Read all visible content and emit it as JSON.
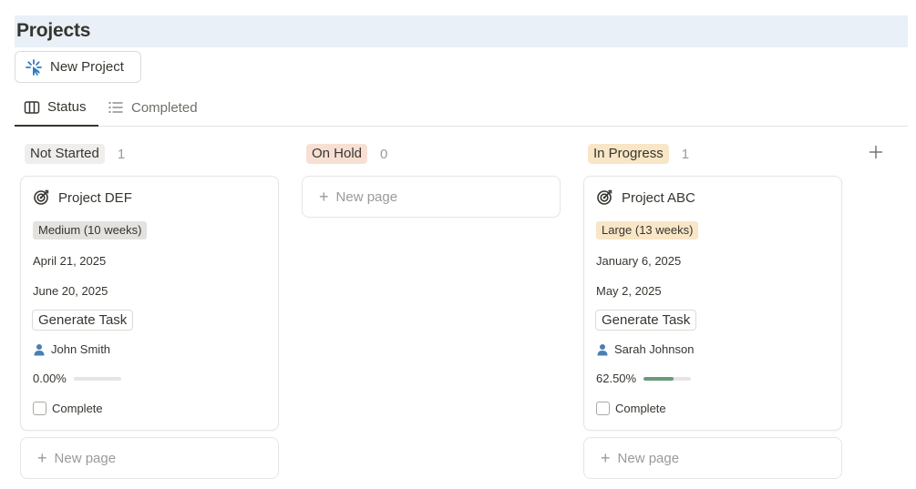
{
  "page": {
    "title": "Projects"
  },
  "toolbar": {
    "new_project_label": "New Project",
    "new_project_icon": "sparkle-icon"
  },
  "tabs": [
    {
      "label": "Status",
      "icon": "board-icon",
      "active": true
    },
    {
      "label": "Completed",
      "icon": "list-icon",
      "active": false
    }
  ],
  "groups": [
    {
      "label": "Not Started",
      "count": "1",
      "pill_color": "#efeeec",
      "cards": [
        {
          "title": "Project DEF",
          "icon": "target-icon",
          "size": "Medium (10 weeks)",
          "size_color": "#e3e2df",
          "start_date": "April 21, 2025",
          "end_date": "June 20, 2025",
          "button_label": "Generate Task",
          "person": "John Smith",
          "progress_text": "0.00%",
          "progress_fraction": 0.0,
          "checkbox_label": "Complete",
          "checked": false
        }
      ],
      "new_page_label": "New page"
    },
    {
      "label": "On Hold",
      "count": "0",
      "pill_color": "#f7e0d3",
      "cards": [],
      "new_page_label": "New page"
    },
    {
      "label": "In Progress",
      "count": "1",
      "pill_color": "#f8e6c6",
      "cards": [
        {
          "title": "Project ABC",
          "icon": "target-icon",
          "size": "Large (13 weeks)",
          "size_color": "#f8e6c6",
          "start_date": "January 6, 2025",
          "end_date": "May 2, 2025",
          "button_label": "Generate Task",
          "person": "Sarah Johnson",
          "progress_text": "62.50%",
          "progress_fraction": 0.625,
          "checkbox_label": "Complete",
          "checked": false
        }
      ],
      "new_page_label": "New page"
    }
  ],
  "colors": {
    "title_bar": "#e9f0f7",
    "progress_fill": "#6a9a7c",
    "person_icon": "#4a7fb5"
  }
}
